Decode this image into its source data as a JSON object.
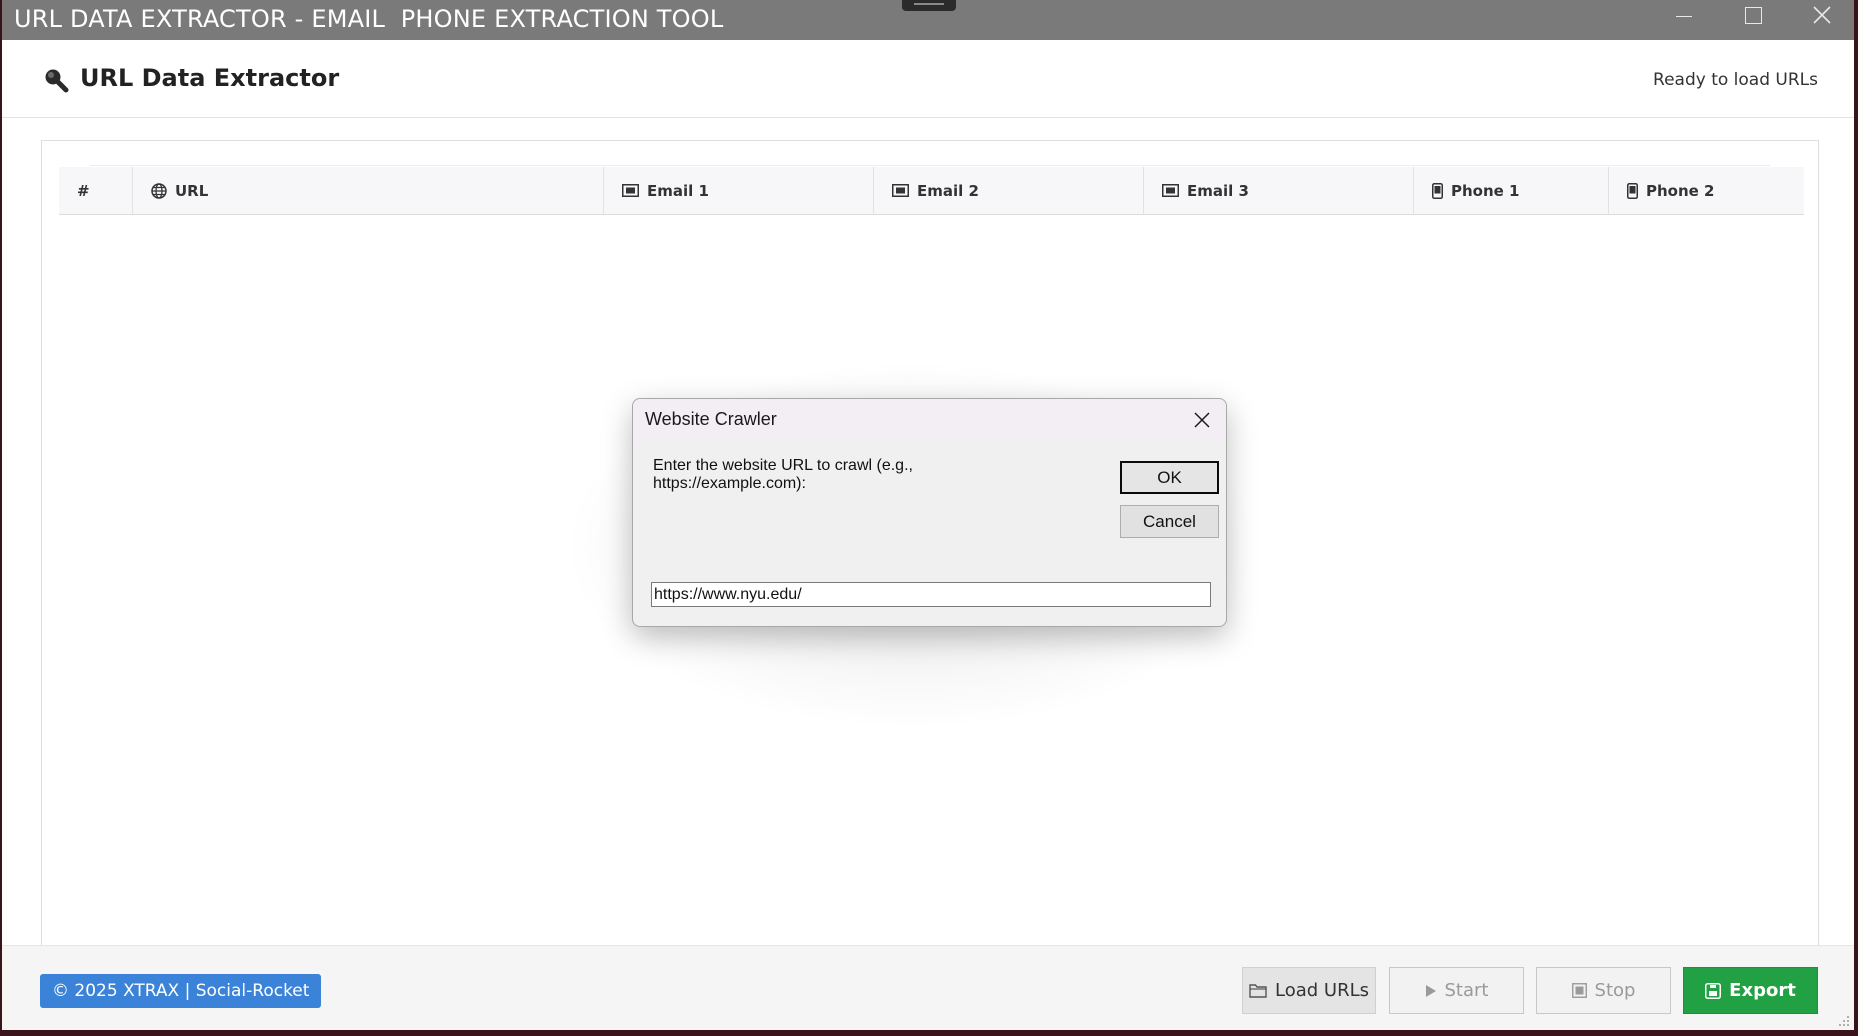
{
  "window": {
    "title": "URL DATA EXTRACTOR - EMAIL  PHONE EXTRACTION TOOL"
  },
  "header": {
    "app_title": "URL Data Extractor",
    "status": "Ready to load URLs"
  },
  "table": {
    "columns": [
      {
        "label": "#",
        "icon": null
      },
      {
        "label": "URL",
        "icon": "globe-icon"
      },
      {
        "label": "Email 1",
        "icon": "envelope-icon"
      },
      {
        "label": "Email 2",
        "icon": "envelope-icon"
      },
      {
        "label": "Email 3",
        "icon": "envelope-icon"
      },
      {
        "label": "Phone 1",
        "icon": "phone-icon"
      },
      {
        "label": "Phone 2",
        "icon": "phone-icon"
      }
    ],
    "rows": []
  },
  "footer": {
    "copyright": "© 2025 XTRAX | Social-Rocket",
    "buttons": {
      "load": "Load URLs",
      "start": "Start",
      "stop": "Stop",
      "export": "Export"
    }
  },
  "dialog": {
    "title": "Website Crawler",
    "prompt": "Enter the website URL to crawl (e.g., https://example.com):",
    "ok": "OK",
    "cancel": "Cancel",
    "input_value": "https://www.nyu.edu/"
  },
  "colors": {
    "titlebar": "#7a7a7a",
    "copyright_badge": "#3a83d8",
    "export_button": "#22a044"
  }
}
